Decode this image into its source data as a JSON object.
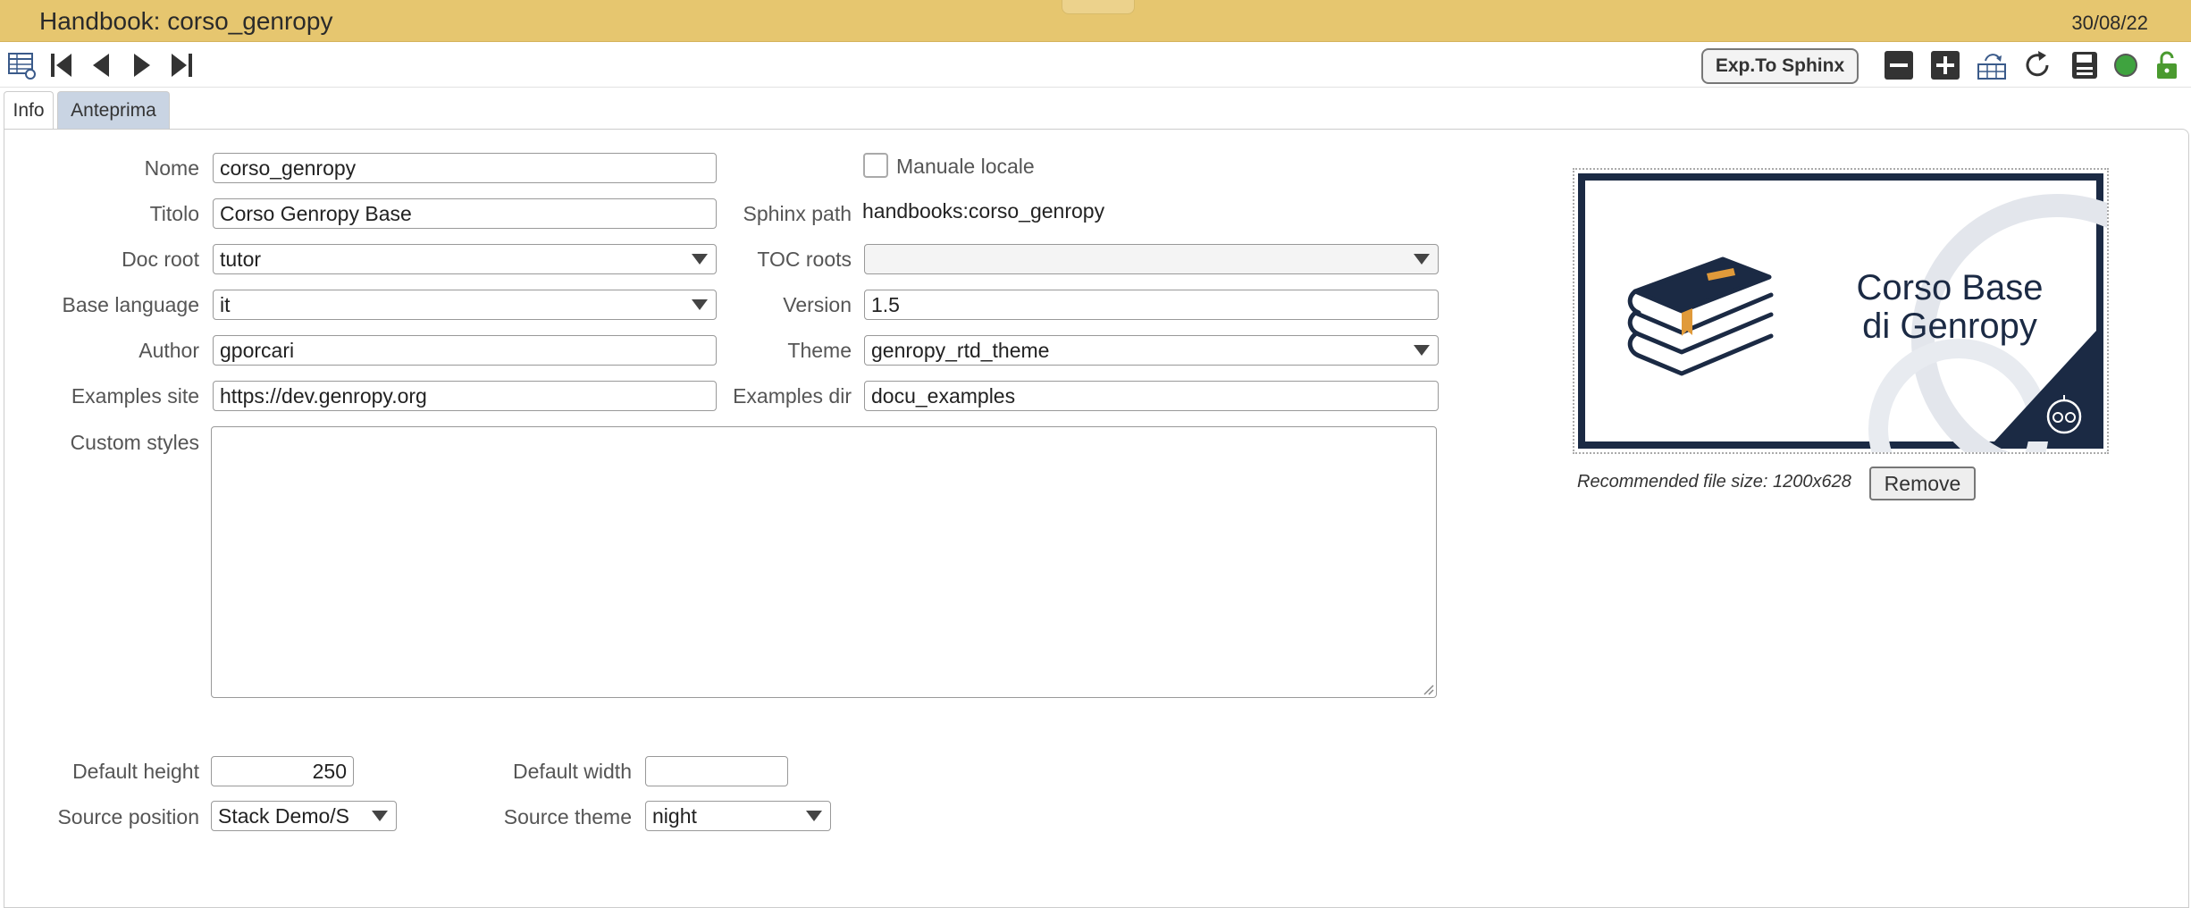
{
  "header": {
    "title": "Handbook: corso_genropy",
    "date": "30/08/22"
  },
  "toolbar": {
    "export_label": "Exp.To Sphinx",
    "icons": [
      "table-view-icon",
      "first-record-icon",
      "previous-record-icon",
      "next-record-icon",
      "last-record-icon",
      "minus-icon",
      "plus-icon",
      "duplicate-icon",
      "reload-icon",
      "save-icon",
      "status-icon",
      "lock-icon"
    ],
    "status_color": "#3fa33f",
    "lock_color": "#4a9a2f"
  },
  "tabs": [
    {
      "label": "Info",
      "active": true
    },
    {
      "label": "Anteprima",
      "active": false
    }
  ],
  "form": {
    "nome": {
      "label": "Nome",
      "value": "corso_genropy"
    },
    "titolo": {
      "label": "Titolo",
      "value": "Corso Genropy Base"
    },
    "doc_root": {
      "label": "Doc root",
      "value": "tutor"
    },
    "base_language": {
      "label": "Base language",
      "value": "it"
    },
    "author": {
      "label": "Author",
      "value": "gporcari"
    },
    "examples_site": {
      "label": "Examples site",
      "value": "https://dev.genropy.org"
    },
    "custom_styles": {
      "label": "Custom styles",
      "value": ""
    },
    "manuale_locale": {
      "label": "Manuale locale",
      "checked": false
    },
    "sphinx_path": {
      "label": "Sphinx path",
      "value": "handbooks:corso_genropy"
    },
    "toc_roots": {
      "label": "TOC roots",
      "value": ""
    },
    "version": {
      "label": "Version",
      "value": "1.5"
    },
    "theme": {
      "label": "Theme",
      "value": "genropy_rtd_theme"
    },
    "examples_dir": {
      "label": "Examples dir",
      "value": "docu_examples"
    },
    "default_height": {
      "label": "Default height",
      "value": "250"
    },
    "default_width": {
      "label": "Default width",
      "value": ""
    },
    "source_position": {
      "label": "Source position",
      "value": "Stack Demo/S"
    },
    "source_theme": {
      "label": "Source theme",
      "value": "night"
    }
  },
  "image": {
    "caption_line1": "Corso Base",
    "caption_line2": "di Genropy",
    "recommended": "Recommended file size: 1200x628",
    "remove_label": "Remove",
    "navy": "#1b2a44"
  }
}
